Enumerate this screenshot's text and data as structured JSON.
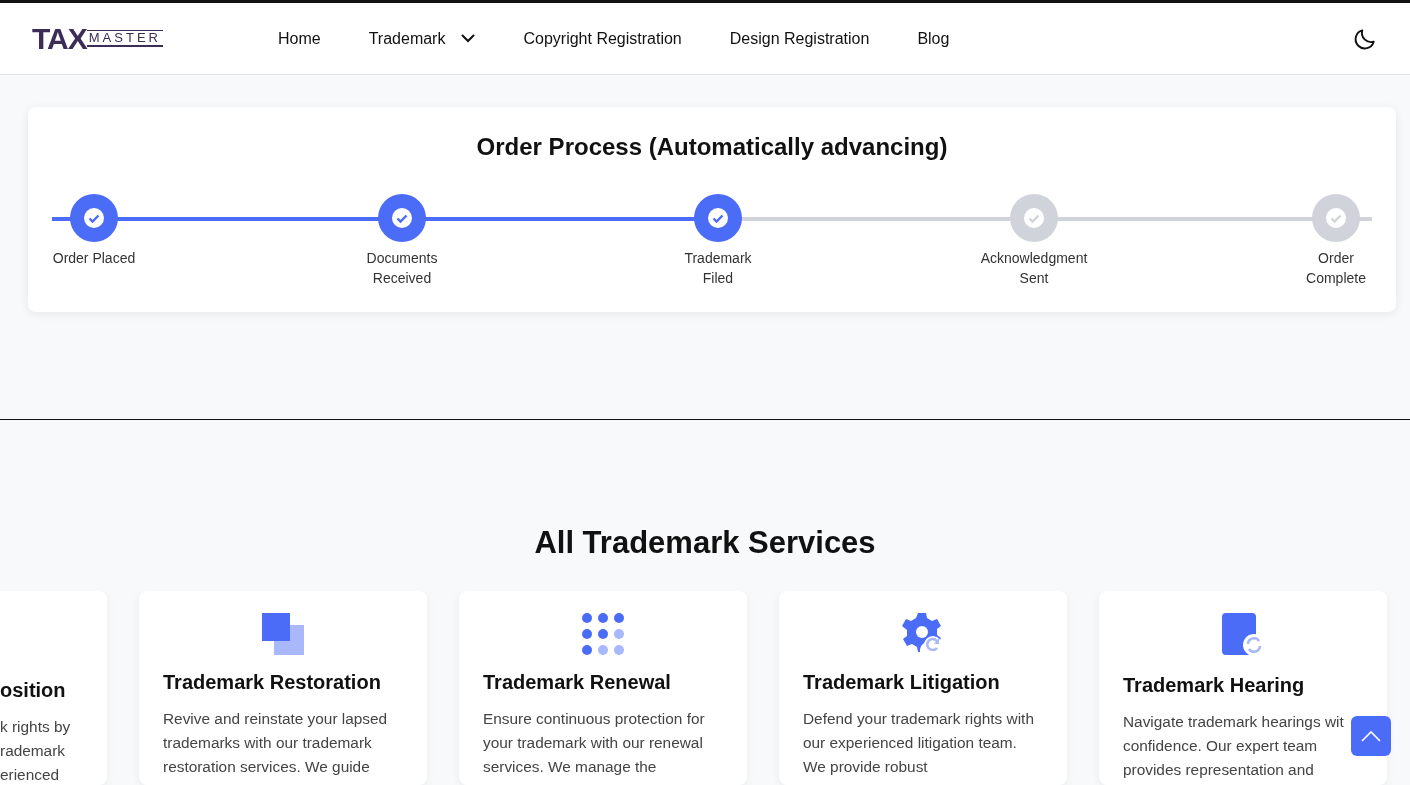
{
  "logo": {
    "mark": "TAX",
    "word": "MASTER"
  },
  "nav": [
    {
      "label": "Home",
      "kind": "link"
    },
    {
      "label": "Trademark",
      "kind": "dropdown"
    },
    {
      "label": "Copyright Registration",
      "kind": "link"
    },
    {
      "label": "Design Registration",
      "kind": "link"
    },
    {
      "label": "Blog",
      "kind": "link"
    }
  ],
  "process": {
    "title": "Order Process (Automatically advancing)",
    "steps": [
      {
        "label": "Order Placed",
        "done": true
      },
      {
        "label": "Documents Received",
        "done": true
      },
      {
        "label": "Trademark Filed",
        "done": true
      },
      {
        "label": "Acknowledgment Sent",
        "done": false
      },
      {
        "label": "Order Complete",
        "done": false
      }
    ]
  },
  "services": {
    "title": "All Trademark Services",
    "cards": [
      {
        "kind": "partial",
        "title": "osition",
        "lines": [
          "k rights by",
          "rademark",
          "erienced"
        ]
      },
      {
        "kind": "squares",
        "title": "Trademark Restoration",
        "text": "Revive and reinstate your lapsed trademarks with our trademark restoration services. We guide"
      },
      {
        "kind": "dots",
        "title": "Trademark Renewal",
        "text": "Ensure continuous protection for your trademark with our renewal services. We manage the"
      },
      {
        "kind": "gear",
        "title": "Trademark Litigation",
        "text": "Defend your trademark rights with our experienced litigation team. We provide robust"
      },
      {
        "kind": "doc",
        "title": "Trademark Hearing",
        "text": "Navigate trademark hearings wit confidence. Our expert team provides representation and"
      }
    ]
  }
}
